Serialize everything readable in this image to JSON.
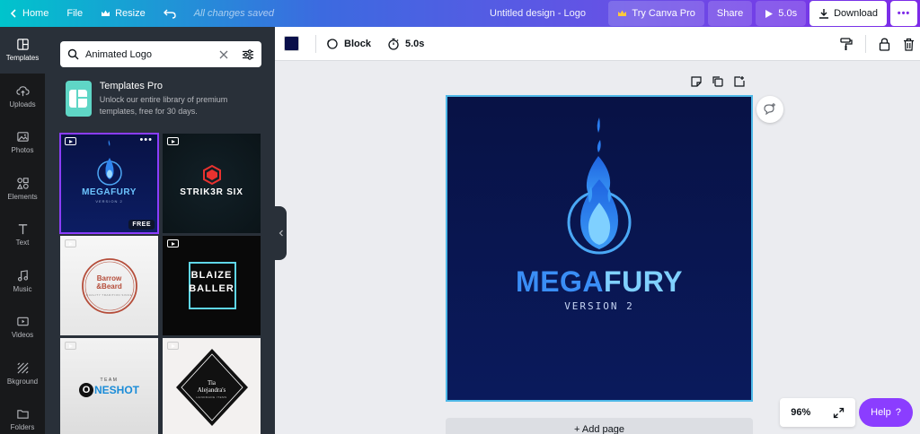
{
  "topbar": {
    "home_label": "Home",
    "file_label": "File",
    "resize_label": "Resize",
    "saved_status": "All changes saved",
    "doc_title": "Untitled design - Logo",
    "try_pro_label": "Try Canva Pro",
    "share_label": "Share",
    "play_duration": "5.0s",
    "download_label": "Download",
    "more_label": "•••"
  },
  "rail": {
    "items": [
      {
        "label": "Templates",
        "icon": "templates-icon"
      },
      {
        "label": "Uploads",
        "icon": "upload-icon"
      },
      {
        "label": "Photos",
        "icon": "photo-icon"
      },
      {
        "label": "Elements",
        "icon": "elements-icon"
      },
      {
        "label": "Text",
        "icon": "text-icon"
      },
      {
        "label": "Music",
        "icon": "music-icon"
      },
      {
        "label": "Videos",
        "icon": "video-icon"
      },
      {
        "label": "Bkground",
        "icon": "background-icon"
      },
      {
        "label": "Folders",
        "icon": "folder-icon"
      }
    ]
  },
  "panel": {
    "search_value": "Animated Logo",
    "promo_title": "Templates Pro",
    "promo_desc": "Unlock our entire library of premium templates, free for 30 days.",
    "templates": [
      {
        "id": "megafury",
        "free_badge": "FREE",
        "title": "MEGAFURY",
        "subtitle": "VERSION 2"
      },
      {
        "id": "striker",
        "title": "STRIK3R SIX"
      },
      {
        "id": "barrow",
        "title_top": "Barrow",
        "title_bottom": "&Beard",
        "subtitle": "QUALITY TRADITION SINCE"
      },
      {
        "id": "blaize",
        "line1": "BLAIZE",
        "line2": "BALLER"
      },
      {
        "id": "oneshot",
        "team": "TEAM",
        "o": "O",
        "rest": "NESHOT"
      },
      {
        "id": "tia",
        "line1": "Tia",
        "line2": "Alejandra's",
        "subtitle": "HANDMADE ITEMS"
      }
    ],
    "more_dots": "•••"
  },
  "subbar": {
    "color": "#0a0f4a",
    "block_label": "Block",
    "duration": "5.0s"
  },
  "canvas": {
    "title_part1": "MEGA",
    "title_part2": "FURY",
    "subtitle": "VERSION 2",
    "add_page_label": "+ Add page"
  },
  "zoom": {
    "value": "96%"
  },
  "help": {
    "label": "Help",
    "icon_char": "?"
  },
  "colors": {
    "accent": "#8b3dff",
    "canvas_bg": "#0a1a5c",
    "logo_light": "#7fd0ff",
    "logo_mid": "#3a8ef6",
    "panel_bg": "#293039"
  }
}
